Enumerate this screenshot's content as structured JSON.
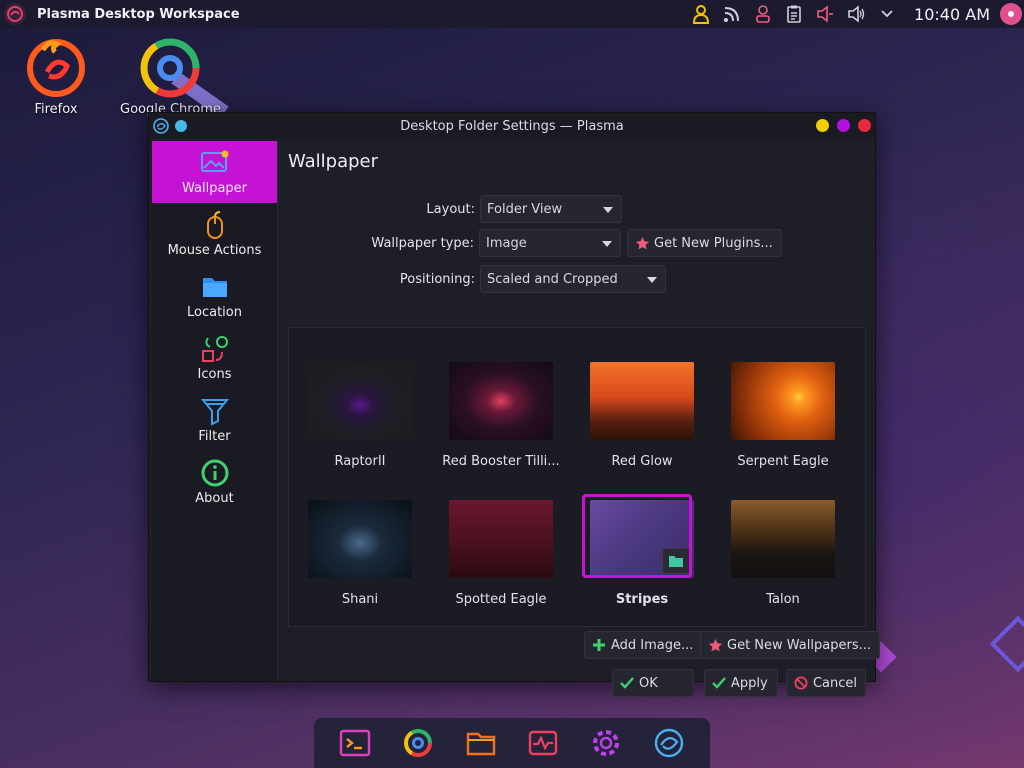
{
  "panel": {
    "title": "Plasma Desktop Workspace",
    "clock": "10:40 AM",
    "tray_icons": [
      "user-icon",
      "rss-icon",
      "person-icon",
      "clipboard-icon",
      "volume-muted-icon",
      "volume-icon",
      "chevron-down-icon"
    ]
  },
  "desktop": {
    "icons": [
      {
        "label": "Firefox"
      },
      {
        "label": "Google Chrome"
      }
    ]
  },
  "window": {
    "title": "Desktop Folder Settings — Plasma",
    "controls": {
      "minimize_color": "#f0d000",
      "maximize_color": "#b010e0",
      "close_color": "#e8283c"
    }
  },
  "sidebar": {
    "items": [
      {
        "label": "Wallpaper",
        "active": true
      },
      {
        "label": "Mouse Actions"
      },
      {
        "label": "Location"
      },
      {
        "label": "Icons"
      },
      {
        "label": "Filter"
      },
      {
        "label": "About"
      }
    ]
  },
  "page": {
    "title": "Wallpaper",
    "layout": {
      "label": "Layout:",
      "value": "Folder View"
    },
    "wallpaper_type": {
      "label": "Wallpaper type:",
      "value": "Image"
    },
    "get_plugins": "Get New Plugins...",
    "positioning": {
      "label": "Positioning:",
      "value": "Scaled and Cropped"
    }
  },
  "wallpapers": [
    {
      "name": "RaptorII"
    },
    {
      "name": "Red Booster Tilli..."
    },
    {
      "name": "Red Glow"
    },
    {
      "name": "Serpent Eagle"
    },
    {
      "name": "Shani"
    },
    {
      "name": "Spotted Eagle"
    },
    {
      "name": "Stripes",
      "selected": true
    },
    {
      "name": "Talon"
    }
  ],
  "actions": {
    "add_image": "Add Image...",
    "get_wallpapers": "Get New Wallpapers...",
    "ok": "OK",
    "apply": "Apply",
    "cancel": "Cancel"
  },
  "colors": {
    "accent": "#c512d4",
    "window_bg": "#1e1e27"
  }
}
